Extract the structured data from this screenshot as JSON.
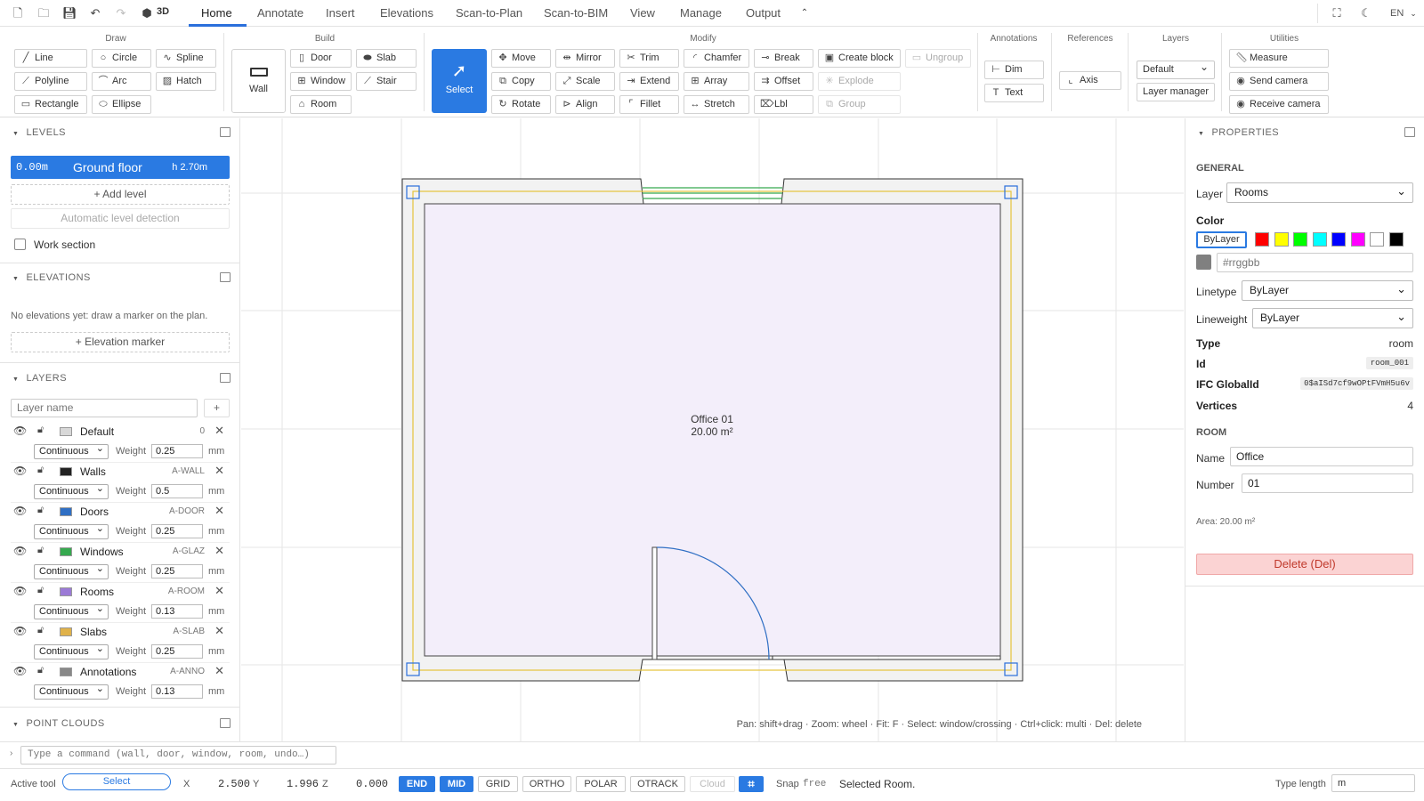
{
  "topbar": {
    "view3d": "3D",
    "tabs": [
      "Home",
      "Annotate",
      "Insert",
      "Elevations",
      "Scan-to-Plan",
      "Scan-to-BIM",
      "View",
      "Manage",
      "Output"
    ],
    "lang": "EN"
  },
  "ribbon": {
    "groups": {
      "draw": "Draw",
      "build": "Build",
      "modify": "Modify",
      "annotations": "Annotations",
      "references": "References",
      "layers": "Layers",
      "utilities": "Utilities"
    },
    "draw": [
      "Line",
      "Circle",
      "Spline",
      "Polyline",
      "Arc",
      "Hatch",
      "Rectangle",
      "Ellipse"
    ],
    "build": {
      "wall": "Wall",
      "items": [
        "Door",
        "Slab",
        "Window",
        "Stair",
        "Room"
      ]
    },
    "select": "Select",
    "modify": [
      "Move",
      "Mirror",
      "Trim",
      "Chamfer",
      "Break",
      "Create block",
      "Ungroup",
      "Copy",
      "Scale",
      "Extend",
      "Array",
      "Offset",
      "Explode",
      "Rotate",
      "Align",
      "Fillet",
      "Stretch",
      "Lbl",
      "Group"
    ],
    "annotations": [
      "Dim",
      "Text"
    ],
    "references": [
      "Axis"
    ],
    "layers": {
      "current": "Default",
      "manager": "Layer manager"
    },
    "utilities": [
      "Measure",
      "Send camera",
      "Receive camera"
    ]
  },
  "left": {
    "levels_title": "LEVELS",
    "level": {
      "elev": "0.00m",
      "name": "Ground floor",
      "height": "h 2.70m"
    },
    "add_level": "+ Add level",
    "auto_detect": "Automatic level detection",
    "work_section": "Work section",
    "elevations_title": "ELEVATIONS",
    "elevations_empty": "No elevations yet: draw a marker on the plan.",
    "elevation_marker": "+ Elevation marker",
    "layers_title": "LAYERS",
    "layer_placeholder": "Layer name",
    "add": "+",
    "weight_label": "Weight",
    "unit": "mm",
    "layers": [
      {
        "name": "Default",
        "code": "0",
        "linetype": "Continuous",
        "weight": "0.25",
        "color": "#d8d8d8"
      },
      {
        "name": "Walls",
        "code": "A-WALL",
        "linetype": "Continuous",
        "weight": "0.5",
        "color": "#222222"
      },
      {
        "name": "Doors",
        "code": "A-DOOR",
        "linetype": "Continuous",
        "weight": "0.25",
        "color": "#2f6fc4"
      },
      {
        "name": "Windows",
        "code": "A-GLAZ",
        "linetype": "Continuous",
        "weight": "0.25",
        "color": "#36a94f"
      },
      {
        "name": "Rooms",
        "code": "A-ROOM",
        "linetype": "Continuous",
        "weight": "0.13",
        "color": "#9b7ad6"
      },
      {
        "name": "Slabs",
        "code": "A-SLAB",
        "linetype": "Continuous",
        "weight": "0.25",
        "color": "#e0b24a"
      },
      {
        "name": "Annotations",
        "code": "A-ANNO",
        "linetype": "Continuous",
        "weight": "0.13",
        "color": "#888888"
      }
    ],
    "point_clouds_title": "POINT CLOUDS"
  },
  "canvas": {
    "room_name": "Office 01",
    "room_area": "20.00 m²",
    "hint": "Pan: shift+drag · Zoom: wheel · Fit: F · Select: window/crossing · Ctrl+click: multi · Del: delete"
  },
  "properties": {
    "title": "PROPERTIES",
    "general": "GENERAL",
    "layer_label": "Layer",
    "layer_value": "Rooms",
    "color_label": "Color",
    "bylayer": "ByLayer",
    "swatches": [
      "#ff0000",
      "#ffff00",
      "#00ff00",
      "#00ffff",
      "#0000ff",
      "#ff00ff",
      "#ffffff",
      "#000000"
    ],
    "hex_placeholder": "#rrggbb",
    "linetype_label": "Linetype",
    "linetype_value": "ByLayer",
    "lineweight_label": "Lineweight",
    "lineweight_value": "ByLayer",
    "type_label": "Type",
    "type_value": "room",
    "id_label": "Id",
    "id_value": "room_001",
    "ifc_label": "IFC GlobalId",
    "ifc_value": "0$aISd7cf9wOPtFVmH5u6v",
    "vertices_label": "Vertices",
    "vertices_value": "4",
    "room": "ROOM",
    "name_label": "Name",
    "name_value": "Office",
    "number_label": "Number",
    "number_value": "01",
    "area": "Area: 20.00 m²",
    "delete": "Delete (Del)"
  },
  "command": {
    "placeholder": "Type a command (wall, door, window, room, undo…)"
  },
  "status": {
    "active_tool_label": "Active tool",
    "active_tool": "Select",
    "x_label": "X",
    "x": "2.500",
    "y_label": "Y",
    "y": "1.996",
    "z_label": "Z",
    "z": "0.000",
    "toggles": [
      "END",
      "MID",
      "GRID",
      "ORTHO",
      "POLAR",
      "OTRACK",
      "Cloud"
    ],
    "snap_label": "Snap",
    "snap_value": "free",
    "message": "Selected Room.",
    "type_length_label": "Type length",
    "type_length_value": "m"
  },
  "colors": {
    "accent": "#2a7ae2",
    "room_fill": "#f3eefa",
    "wall_fill": "#f2f2f2",
    "axis": "#e5c33a",
    "door": "#2f6fc4",
    "window": "#36a94f",
    "delete_bg": "#fbd3d3"
  }
}
